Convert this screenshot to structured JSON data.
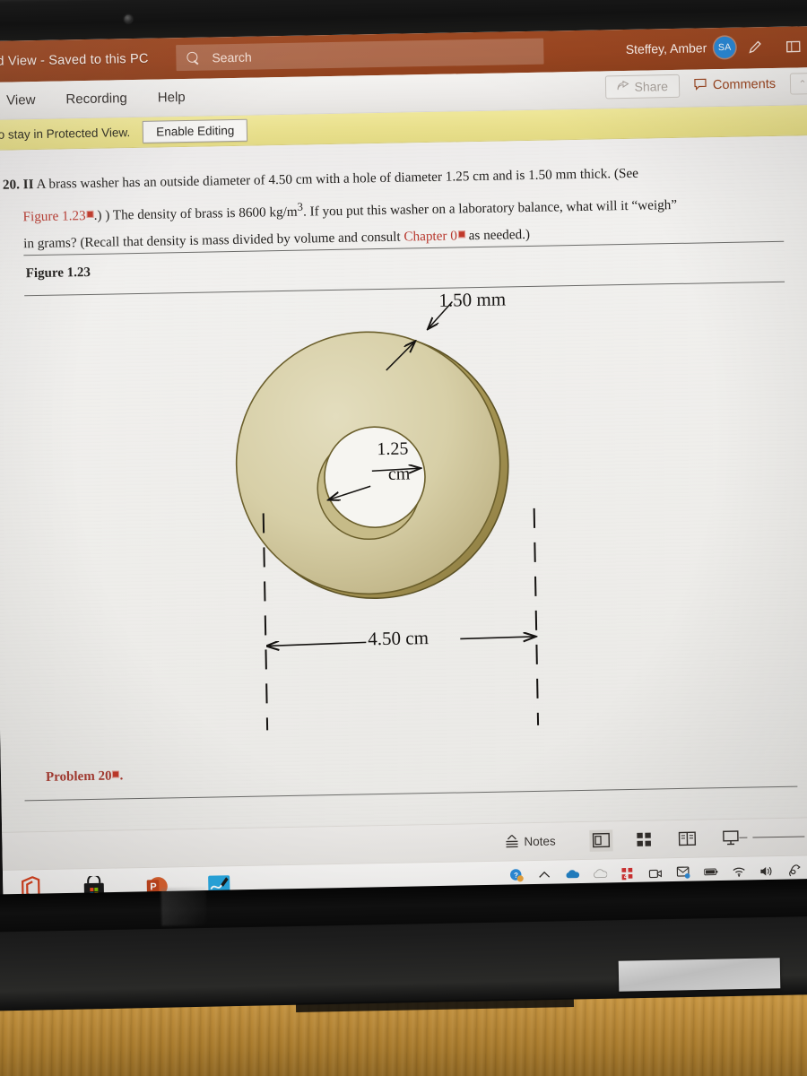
{
  "app": {
    "title_bar_text": "d View  -  Saved to this PC",
    "search_placeholder": "Search",
    "account_name": "Steffey, Amber",
    "account_initials": "SA",
    "pen_icon": "pen-icon",
    "restore_icon": "restore-window-icon"
  },
  "ribbon": {
    "tabs": [
      {
        "label": "View"
      },
      {
        "label": "Recording"
      },
      {
        "label": "Help"
      }
    ],
    "share_label": "Share",
    "comments_label": "Comments",
    "minimize_ribbon_label": "⌃"
  },
  "protected_view": {
    "message": "to stay in Protected View.",
    "enable_button": "Enable Editing"
  },
  "slide": {
    "problem_number": "20.",
    "problem_difficulty": "II",
    "problem_text_1": "A brass washer has an outside diameter of 4.50 cm with a hole of diameter 1.25 cm and is 1.50 mm thick. (See",
    "problem_link_1": "Figure 1.23",
    "problem_text_2": ") The density of brass is 8600 kg/m",
    "problem_exponent": "3",
    "problem_text_3": ". If you put this washer on a laboratory balance, what will it “weigh”",
    "problem_text_4": "in grams? (Recall that density is mass divided by volume and consult",
    "problem_link_2": "Chapter 0",
    "problem_text_5": "as needed.)",
    "figure_label": "Figure 1.23",
    "problem_caption": "Problem 20",
    "paren_close": ".)",
    "period": "."
  },
  "figure": {
    "thickness_label": "1.50 mm",
    "hole_label_line1": "1.25",
    "hole_label_line2": "cm",
    "outer_label": "4.50 cm",
    "washer_face_color": "#d9d2ab",
    "washer_rim_color": "#a6964f",
    "washer_edge_color": "#6b5f2c",
    "hole_fill_color": "#f5f4f0"
  },
  "status_bar": {
    "notes_label": "Notes",
    "views": [
      {
        "name": "normal-view"
      },
      {
        "name": "slide-sorter-view"
      },
      {
        "name": "reading-view"
      },
      {
        "name": "slide-show-view"
      }
    ],
    "zoom_out_label": "−"
  },
  "taskbar": {
    "apps": [
      {
        "name": "office-icon"
      },
      {
        "name": "microsoft-store-icon"
      },
      {
        "name": "powerpoint-icon"
      },
      {
        "name": "whiteboard-icon"
      }
    ],
    "tray": [
      {
        "name": "help-notification-icon"
      },
      {
        "name": "chevron-up-icon"
      },
      {
        "name": "onedrive-blue-icon"
      },
      {
        "name": "onedrive-white-icon"
      },
      {
        "name": "adobe-icon"
      },
      {
        "name": "camera-icon"
      },
      {
        "name": "outlook-icon"
      },
      {
        "name": "battery-icon"
      },
      {
        "name": "wifi-icon"
      },
      {
        "name": "volume-icon"
      },
      {
        "name": "pen-tray-icon"
      },
      {
        "name": "notification-center-icon"
      }
    ]
  },
  "colors": {
    "ribbon_accent": "#9b4621",
    "protected_view_bg": "#e9e08d",
    "link_red": "#b8392f",
    "avatar_blue": "#2b8ad8"
  }
}
